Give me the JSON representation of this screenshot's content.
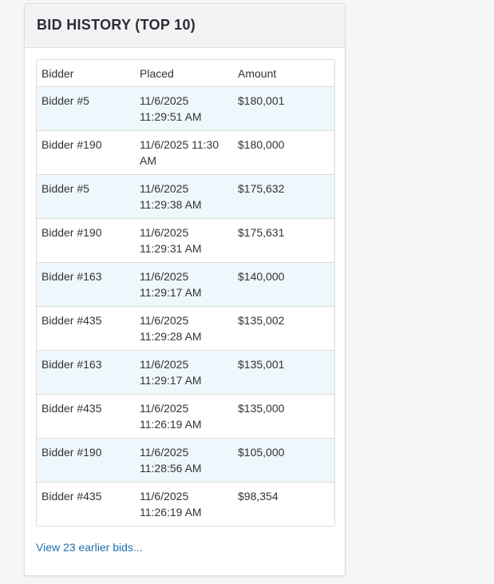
{
  "panel": {
    "title": "BID HISTORY (TOP 10)"
  },
  "table": {
    "headers": [
      "Bidder",
      "Placed",
      "Amount"
    ],
    "rows": [
      {
        "bidder": "Bidder #5",
        "placed": "11/6/2025 11:29:51 AM",
        "amount": "$180,001"
      },
      {
        "bidder": "Bidder #190",
        "placed": "11/6/2025 11:30 AM",
        "amount": "$180,000"
      },
      {
        "bidder": "Bidder #5",
        "placed": "11/6/2025 11:29:38 AM",
        "amount": "$175,632"
      },
      {
        "bidder": "Bidder #190",
        "placed": "11/6/2025 11:29:31 AM",
        "amount": "$175,631"
      },
      {
        "bidder": "Bidder #163",
        "placed": "11/6/2025 11:29:17 AM",
        "amount": "$140,000"
      },
      {
        "bidder": "Bidder #435",
        "placed": "11/6/2025 11:29:28 AM",
        "amount": "$135,002"
      },
      {
        "bidder": "Bidder #163",
        "placed": "11/6/2025 11:29:17 AM",
        "amount": "$135,001"
      },
      {
        "bidder": "Bidder #435",
        "placed": "11/6/2025 11:26:19 AM",
        "amount": "$135,000"
      },
      {
        "bidder": "Bidder #190",
        "placed": "11/6/2025 11:28:56 AM",
        "amount": "$105,000"
      },
      {
        "bidder": "Bidder #435",
        "placed": "11/6/2025 11:26:19 AM",
        "amount": "$98,354"
      }
    ]
  },
  "footer": {
    "earlier_bids_link": "View 23 earlier bids..."
  },
  "colors": {
    "link": "#1f6fb0",
    "row_highlight": "#eef7fb",
    "header_bg": "#f3f3f3"
  }
}
